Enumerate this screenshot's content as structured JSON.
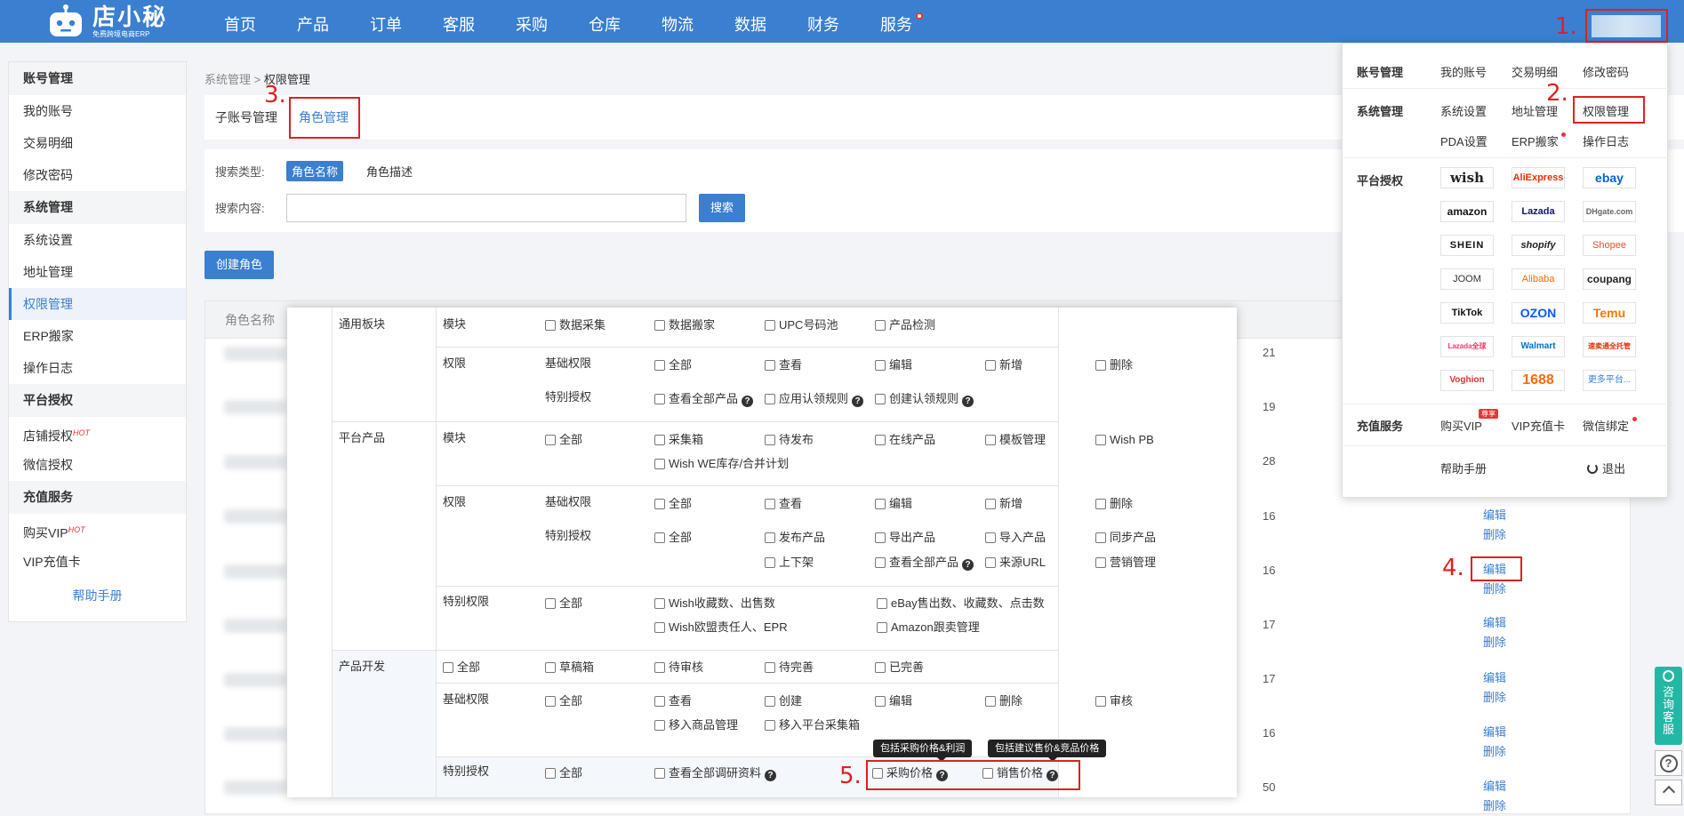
{
  "app": {
    "logo_name": "店小秘",
    "logo_sub": "免费跨境电商ERP"
  },
  "nav": [
    "首页",
    "产品",
    "订单",
    "客服",
    "采购",
    "仓库",
    "物流",
    "数据",
    "财务",
    "服务"
  ],
  "annotations": {
    "a1": "1.",
    "a2": "2.",
    "a3": "3.",
    "a4": "4.",
    "a5": "5."
  },
  "sidebar": {
    "g1": "账号管理",
    "my_account": "我的账号",
    "transactions": "交易明细",
    "change_password": "修改密码",
    "g2": "系统管理",
    "system_settings": "系统设置",
    "address": "地址管理",
    "permissions": "权限管理",
    "erp_move": "ERP搬家",
    "op_log": "操作日志",
    "g3": "平台授权",
    "store_auth": "店铺授权",
    "hot": "HOT",
    "wechat_auth": "微信授权",
    "g4": "充值服务",
    "buy_vip": "购买VIP",
    "vip_card": "VIP充值卡",
    "help": "帮助手册"
  },
  "breadcrumb": {
    "parent": "系统管理",
    "sep": ">",
    "current": "权限管理"
  },
  "tabs": {
    "sub_account": "子账号管理",
    "role": "角色管理"
  },
  "search": {
    "type_label": "搜索类型:",
    "type_name": "角色名称",
    "type_desc": "角色描述",
    "content_label": "搜索内容:",
    "button": "搜索"
  },
  "create_role": "创建角色",
  "table": {
    "col_name": "角色名称",
    "edit": "编辑",
    "delete": "删除",
    "num_frags": [
      "21",
      "19",
      "28",
      "16",
      "16",
      "17",
      "17",
      "16",
      "50"
    ]
  },
  "dropdown": {
    "account": "账号管理",
    "my_account": "我的账号",
    "transactions": "交易明细",
    "change_password": "修改密码",
    "system": "系统管理",
    "system_settings": "系统设置",
    "address": "地址管理",
    "permissions": "权限管理",
    "pda": "PDA设置",
    "erp_move": "ERP搬家",
    "op_log": "操作日志",
    "platform": "平台授权",
    "platforms": [
      "wish",
      "AliExpress",
      "ebay",
      "amazon",
      "Lazada",
      "DHgate.com",
      "SHEIN",
      "shopify",
      "Shopee",
      "JOOM",
      "Alibaba",
      "coupang",
      "TikTok",
      "OZON",
      "Temu",
      "Lazada全球",
      "Walmart",
      "速卖通全托管",
      "Voghion",
      "1688",
      "更多平台..."
    ],
    "recharge": "充值服务",
    "buy_vip": "购买VIP",
    "vip_badge": "尊享",
    "vip_card": "VIP充值卡",
    "wechat_bind": "微信绑定",
    "help": "帮助手册",
    "logout": "退出"
  },
  "perm": {
    "s1": "通用板块",
    "s2": "平台产品",
    "s3": "产品开发",
    "module": "模块",
    "rights": "权限",
    "basic": "基础权限",
    "special_auth": "特别授权",
    "special_rights": "特别权限",
    "r1": [
      "数据采集",
      "数据搬家",
      "UPC号码池",
      "产品检测"
    ],
    "r2": [
      "全部",
      "查看",
      "编辑",
      "新增",
      "删除"
    ],
    "r3": [
      "查看全部产品",
      "应用认领规则",
      "创建认领规则"
    ],
    "r4": [
      "全部",
      "采集箱",
      "待发布",
      "在线产品",
      "模板管理",
      "Wish PB"
    ],
    "r4b": "Wish WE库存/合并计划",
    "r5": [
      "全部",
      "查看",
      "编辑",
      "新增",
      "删除"
    ],
    "r6": [
      "全部",
      "发布产品",
      "导出产品",
      "导入产品",
      "同步产品"
    ],
    "r6b": [
      "上下架",
      "查看全部产品",
      "来源URL",
      "营销管理"
    ],
    "r7": [
      "全部",
      "Wish收藏数、出售数",
      "eBay售出数、收藏数、点击数"
    ],
    "r7b": [
      "Wish欧盟责任人、EPR",
      "Amazon跟卖管理"
    ],
    "r8": [
      "全部",
      "草稿箱",
      "待审核",
      "待完善",
      "已完善"
    ],
    "r9": [
      "全部",
      "查看",
      "创建",
      "编辑",
      "删除",
      "审核"
    ],
    "r9b": [
      "移入商品管理",
      "移入平台采集箱"
    ],
    "r10": [
      "全部",
      "查看全部调研资料",
      "采购价格",
      "销售价格"
    ],
    "tip1": "包括采购价格&利润",
    "tip2": "包括建议售价&竞品价格"
  },
  "float": {
    "consult": "咨询客服",
    "help": "?",
    "top": "^"
  }
}
